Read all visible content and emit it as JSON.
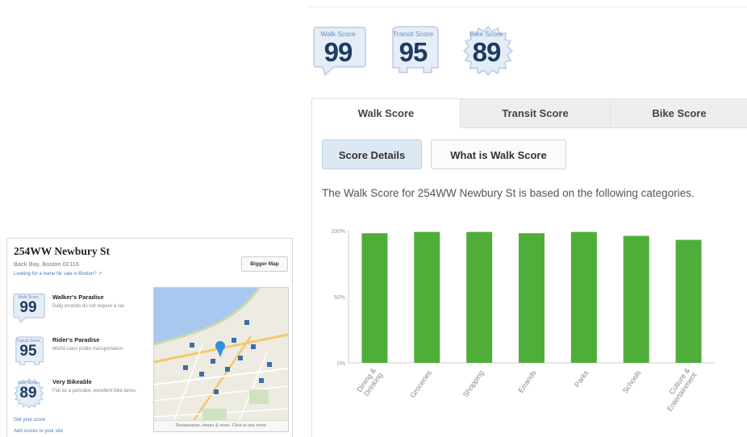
{
  "badges": [
    {
      "label": "Walk Score",
      "score": "99"
    },
    {
      "label": "Transit Score",
      "score": "95"
    },
    {
      "label": "Bike Score",
      "score": "89"
    }
  ],
  "tabs": [
    "Walk Score",
    "Transit Score",
    "Bike Score"
  ],
  "buttons": {
    "details": "Score Details",
    "what": "What is Walk Score"
  },
  "description": "The Walk Score for 254WW Newbury St is based on the following categories.",
  "chart_data": {
    "type": "bar",
    "categories": [
      "Dining & Drinking",
      "Groceries",
      "Shopping",
      "Errands",
      "Parks",
      "Schools",
      "Culture & Entertainment"
    ],
    "values": [
      98,
      99,
      99,
      98,
      99,
      96,
      93
    ],
    "ylim": [
      0,
      100
    ],
    "ytick_labels": [
      "100%",
      "50%",
      "0%"
    ],
    "bar_color": "#4fae3a",
    "grid": false
  },
  "widget": {
    "title": "254WW Newbury St",
    "address": "Back Bay, Boston 02116",
    "link": "Looking for a home for sale in Boston? ",
    "bigger_map": "Bigger Map",
    "scores": [
      {
        "label": "Walk Score",
        "score": "99",
        "heading": "Walker's Paradise",
        "sub": "Daily errands do not require a car."
      },
      {
        "label": "Transit Score",
        "score": "95",
        "heading": "Rider's Paradise",
        "sub": "World-class public transportation."
      },
      {
        "label": "Bike Score",
        "score": "89",
        "heading": "Very Bikeable",
        "sub": "Flat as a pancake, excellent bike lanes."
      }
    ],
    "footer_links": [
      "Get your score",
      "Add scores to your site"
    ],
    "map_caption": "Restaurants, shops & more. Click to see more"
  }
}
